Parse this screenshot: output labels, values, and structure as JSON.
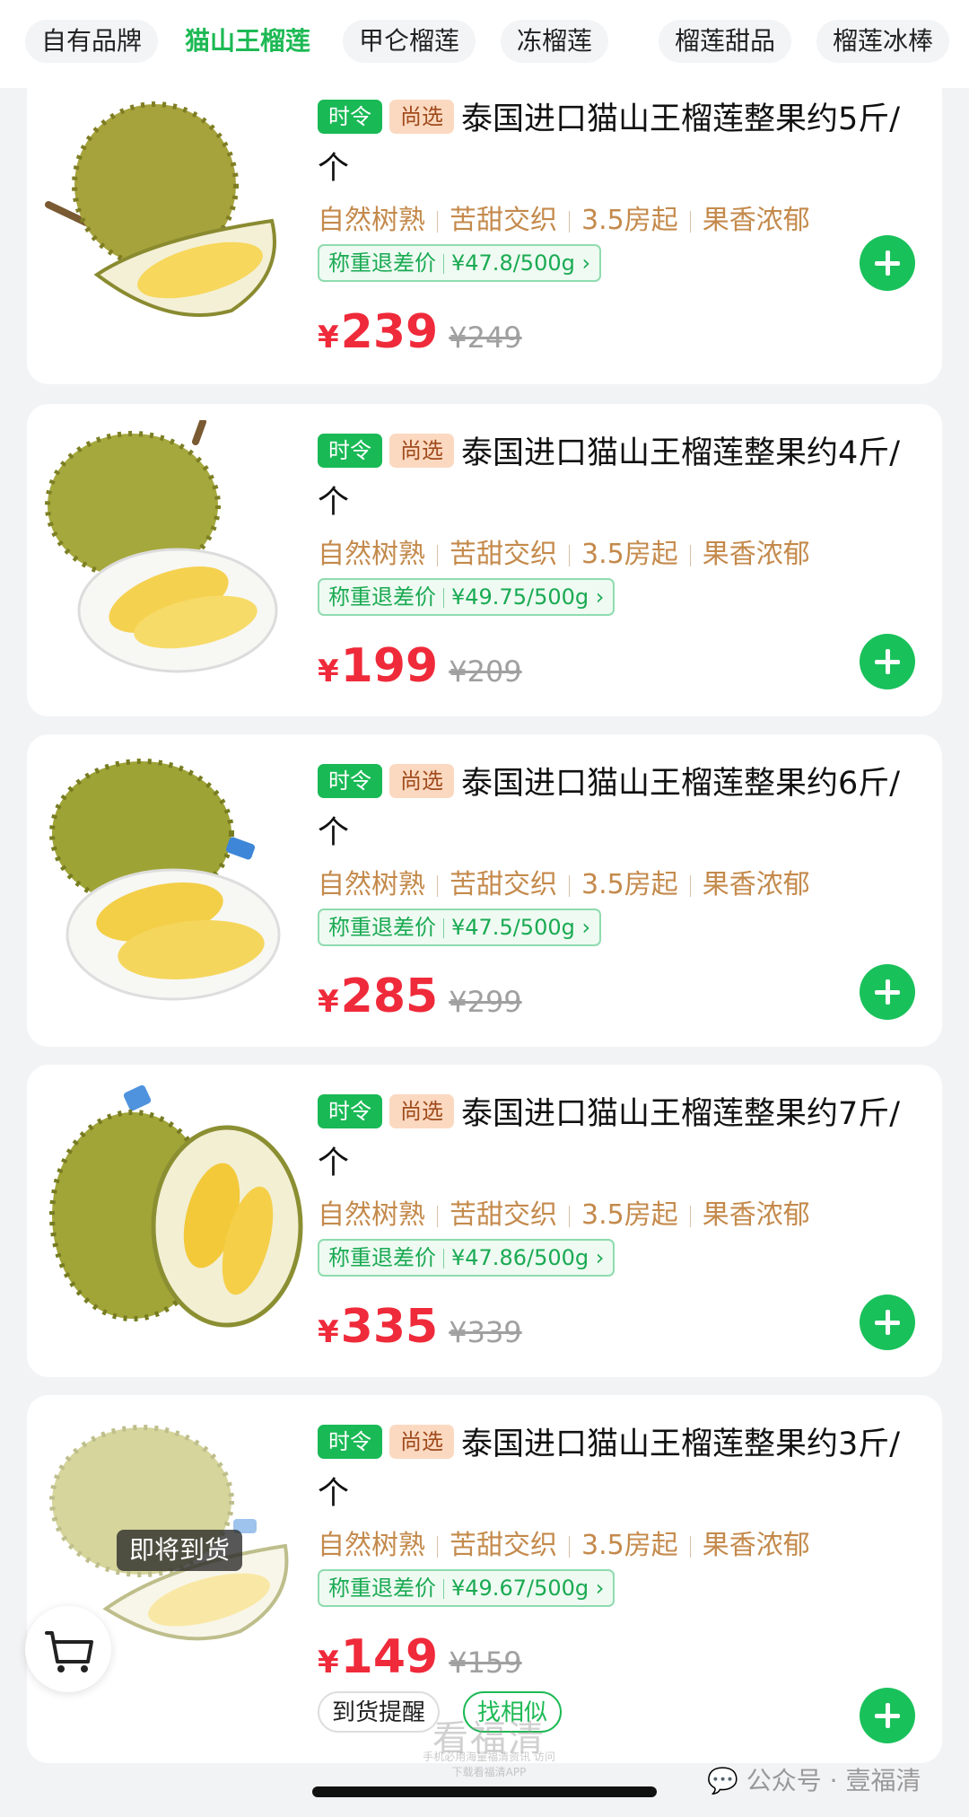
{
  "tabs": [
    "自有品牌",
    "猫山王榴莲",
    "甲仑榴莲",
    "冻榴莲",
    "榴莲甜品",
    "榴莲冰棒"
  ],
  "active_tab": "猫山王榴莲",
  "tags": {
    "season": "时令",
    "select": "尚选"
  },
  "products": [
    {
      "title": "泰国进口猫山王榴莲整果约5斤/个",
      "features": [
        "自然树熟",
        "苦甜交织",
        "3.5房起",
        "果香浓郁"
      ],
      "refund_label": "称重退差价",
      "refund_price": "¥47.8/500g",
      "price": "239",
      "orig_price": "¥249"
    },
    {
      "title": "泰国进口猫山王榴莲整果约4斤/个",
      "features": [
        "自然树熟",
        "苦甜交织",
        "3.5房起",
        "果香浓郁"
      ],
      "refund_label": "称重退差价",
      "refund_price": "¥49.75/500g",
      "price": "199",
      "orig_price": "¥209"
    },
    {
      "title": "泰国进口猫山王榴莲整果约6斤/个",
      "features": [
        "自然树熟",
        "苦甜交织",
        "3.5房起",
        "果香浓郁"
      ],
      "refund_label": "称重退差价",
      "refund_price": "¥47.5/500g",
      "price": "285",
      "orig_price": "¥299"
    },
    {
      "title": "泰国进口猫山王榴莲整果约7斤/个",
      "features": [
        "自然树熟",
        "苦甜交织",
        "3.5房起",
        "果香浓郁"
      ],
      "refund_label": "称重退差价",
      "refund_price": "¥47.86/500g",
      "price": "335",
      "orig_price": "¥339"
    },
    {
      "title": "泰国进口猫山王榴莲整果约3斤/个",
      "features": [
        "自然树熟",
        "苦甜交织",
        "3.5房起",
        "果香浓郁"
      ],
      "refund_label": "称重退差价",
      "refund_price": "¥49.67/500g",
      "price": "149",
      "orig_price": "¥159",
      "status_badge": "即将到货",
      "remind_label": "到货提醒",
      "similar_label": "找相似"
    }
  ],
  "currency_symbol": "¥",
  "watermark": {
    "logo": "看福清",
    "sub": "手机必用海量福清资讯 访问下载看福清APP"
  },
  "footer_source": "公众号 · 壹福清",
  "colors": {
    "accent_green": "#19c15a",
    "price_red": "#ef2a3a",
    "feature_tan": "#c48a4c"
  }
}
